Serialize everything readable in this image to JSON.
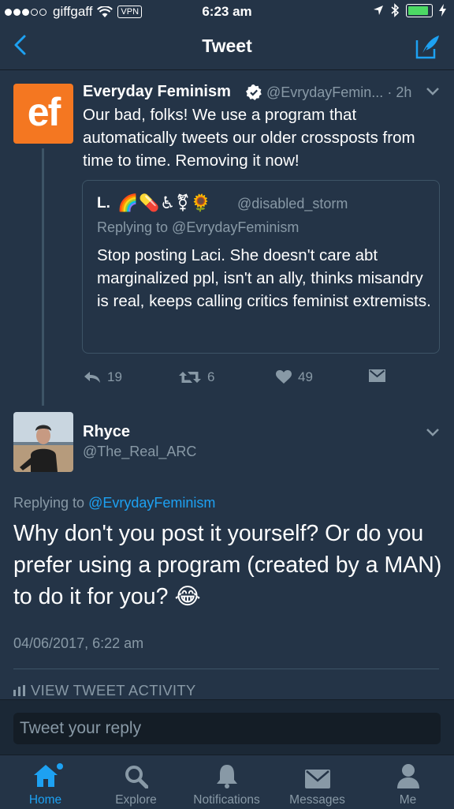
{
  "status_bar": {
    "carrier": "giffgaff",
    "vpn": "VPN",
    "time": "6:23 am",
    "icons": [
      "signal-dots-icon",
      "wifi-icon",
      "location-arrow-icon",
      "bluetooth-icon",
      "battery-icon",
      "charging-bolt-icon"
    ],
    "battery_level": 0.9
  },
  "nav": {
    "title": "Tweet",
    "back_icon": "chevron-left-icon",
    "compose_icon": "compose-quill-icon"
  },
  "tweet": {
    "avatar_text": "ef",
    "name": "Everyday Feminism",
    "handle": "@EvrydayFemin...",
    "time": "· 2h",
    "text": "Our bad, folks! We use a program that automatically tweets our older crossposts from time to time. Removing it now!",
    "quote": {
      "name": "L.",
      "emoji": "🌈💊♿⚧🌻",
      "handle": "@disabled_storm",
      "replying": "Replying to @EvrydayFeminism",
      "text": "Stop posting Laci. She doesn't care abt marginalized ppl, isn't an ally, thinks misandry is real, keeps calling critics feminist extremists."
    },
    "actions": {
      "replies": "19",
      "retweets": "6",
      "likes": "49"
    }
  },
  "reply_tweet": {
    "name": "Rhyce",
    "handle": "@The_Real_ARC",
    "replying_prefix": "Replying to ",
    "replying_handle": "@EvrydayFeminism",
    "text": "Why don't you post it yourself? Or do you prefer using a program (created by a MAN) to do it for you? 😂",
    "date": "04/06/2017, 6:22 am",
    "activity": "VIEW TWEET ACTIVITY"
  },
  "composer": {
    "placeholder": "Tweet your reply"
  },
  "tabs": [
    {
      "label": "Home",
      "icon": "home-icon",
      "active": true
    },
    {
      "label": "Explore",
      "icon": "search-icon",
      "active": false
    },
    {
      "label": "Notifications",
      "icon": "bell-icon",
      "active": false
    },
    {
      "label": "Messages",
      "icon": "envelope-icon",
      "active": false
    },
    {
      "label": "Me",
      "icon": "person-icon",
      "active": false
    }
  ],
  "colors": {
    "background": "#243447",
    "accent": "#1da1f2",
    "muted": "#8899a6",
    "ef_brand": "#f47721"
  }
}
